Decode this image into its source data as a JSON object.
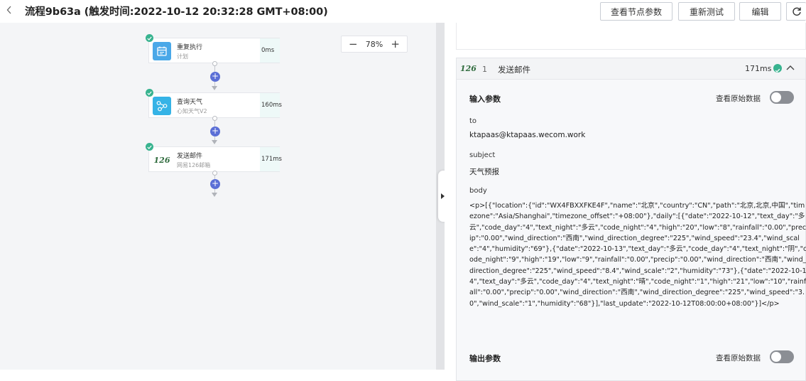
{
  "header": {
    "back_icon": "chevron-left-icon",
    "title": "流程9b63a (触发时间:2022-10-12 20:32:28 GMT+08:00)",
    "buttons": {
      "view_params": "查看节点参数",
      "retest": "重新测试",
      "edit": "编辑"
    },
    "refresh_icon": "refresh-icon"
  },
  "canvas": {
    "zoom": {
      "minus": "−",
      "level": "78%",
      "plus": "+"
    },
    "nodes": [
      {
        "name": "重复执行",
        "sub": "计划",
        "time": "0ms",
        "icon": "calendar-icon",
        "status": "success"
      },
      {
        "name": "查询天气",
        "sub": "心知天气V2",
        "time": "160ms",
        "icon": "weather-flow-icon",
        "status": "success"
      },
      {
        "name": "发送邮件",
        "sub": "网易126邮箱",
        "time": "171ms",
        "icon": "126-mail-icon",
        "logo_text": "126",
        "status": "success"
      }
    ]
  },
  "panel": {
    "handle_icon": "caret-right-icon",
    "step": {
      "logo": "126",
      "index": "1",
      "name": "发送邮件",
      "time": "171ms",
      "status_icon": "check-circle-icon",
      "collapse_icon": "chevron-up-icon"
    },
    "input": {
      "title": "输入参数",
      "raw_label": "查看原始数据",
      "raw_on": false,
      "fields": [
        {
          "label": "to",
          "value": "ktapaas@ktapaas.wecom.work"
        },
        {
          "label": "subject",
          "value": "天气预报"
        },
        {
          "label": "body",
          "value": "<p>[{\"location\":{\"id\":\"WX4FBXXFKE4F\",\"name\":\"北京\",\"country\":\"CN\",\"path\":\"北京,北京,中国\",\"timezone\":\"Asia/Shanghai\",\"timezone_offset\":\"+08:00\"},\"daily\":[{\"date\":\"2022-10-12\",\"text_day\":\"多云\",\"code_day\":\"4\",\"text_night\":\"多云\",\"code_night\":\"4\",\"high\":\"20\",\"low\":\"8\",\"rainfall\":\"0.00\",\"precip\":\"0.00\",\"wind_direction\":\"西南\",\"wind_direction_degree\":\"225\",\"wind_speed\":\"23.4\",\"wind_scale\":\"4\",\"humidity\":\"69\"},{\"date\":\"2022-10-13\",\"text_day\":\"多云\",\"code_day\":\"4\",\"text_night\":\"阴\",\"code_night\":\"9\",\"high\":\"19\",\"low\":\"9\",\"rainfall\":\"0.00\",\"precip\":\"0.00\",\"wind_direction\":\"西南\",\"wind_direction_degree\":\"225\",\"wind_speed\":\"8.4\",\"wind_scale\":\"2\",\"humidity\":\"73\"},{\"date\":\"2022-10-14\",\"text_day\":\"多云\",\"code_day\":\"4\",\"text_night\":\"晴\",\"code_night\":\"1\",\"high\":\"21\",\"low\":\"10\",\"rainfall\":\"0.00\",\"precip\":\"0.00\",\"wind_direction\":\"西南\",\"wind_direction_degree\":\"225\",\"wind_speed\":\"3.0\",\"wind_scale\":\"1\",\"humidity\":\"68\"}],\"last_update\":\"2022-10-12T08:00:00+08:00\"}]</p>"
        }
      ]
    },
    "output": {
      "title": "输出参数",
      "raw_label": "查看原始数据",
      "raw_on": false
    }
  },
  "colors": {
    "success": "#38b38f",
    "add": "#5b6fd6",
    "mail_logo": "#2f6b3d",
    "weather_icon": "#35b3e6",
    "calendar_icon": "#4aa8e8"
  }
}
